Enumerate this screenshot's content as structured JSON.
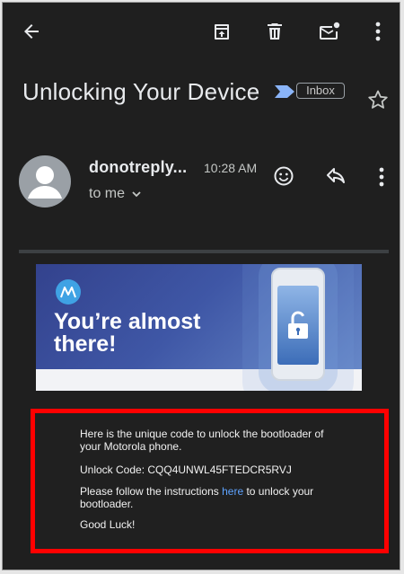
{
  "toolbar": {
    "back_icon": "arrow-back-icon",
    "archive_icon": "archive-icon",
    "delete_icon": "trash-icon",
    "mark_unread_icon": "mark-unread-icon",
    "more_icon": "more-vert-icon"
  },
  "email": {
    "subject": "Unlocking Your Device",
    "label": "Inbox",
    "sender": "donotreply...",
    "time": "10:28 AM",
    "recipient": "to me"
  },
  "banner": {
    "headline_line1": "You’re almost",
    "headline_line2": "there!"
  },
  "message": {
    "intro": "Here is the unique code to unlock the bootloader of your Motorola phone.",
    "code_label": "Unlock Code: CQQ4UNWL45FTEDCR5RVJ",
    "instructions_before": "Please follow the instructions ",
    "instructions_link": "here",
    "instructions_after": " to unlock your bootloader.",
    "signoff": "Good Luck!"
  },
  "colors": {
    "background": "#1f1f1f",
    "highlight_border": "#ff0000",
    "link": "#5ea3ff"
  }
}
